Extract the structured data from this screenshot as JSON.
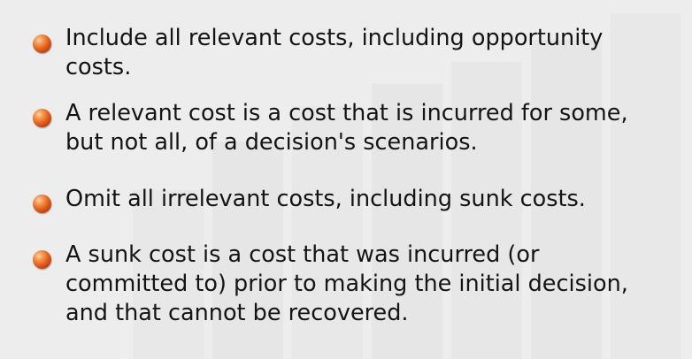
{
  "bullets": [
    {
      "lines": [
        "Include all relevant costs, including opportunity",
        "costs."
      ]
    },
    {
      "lines": [
        "A relevant cost is a cost that is incurred for some,",
        "but not all, of a decision's scenarios."
      ]
    },
    {
      "lines": [
        "Omit all irrelevant costs, including sunk costs."
      ]
    },
    {
      "lines": [
        "A sunk cost is a cost that was incurred (or",
        "committed to) prior to making the initial decision,",
        "and that cannot be recovered."
      ]
    }
  ]
}
